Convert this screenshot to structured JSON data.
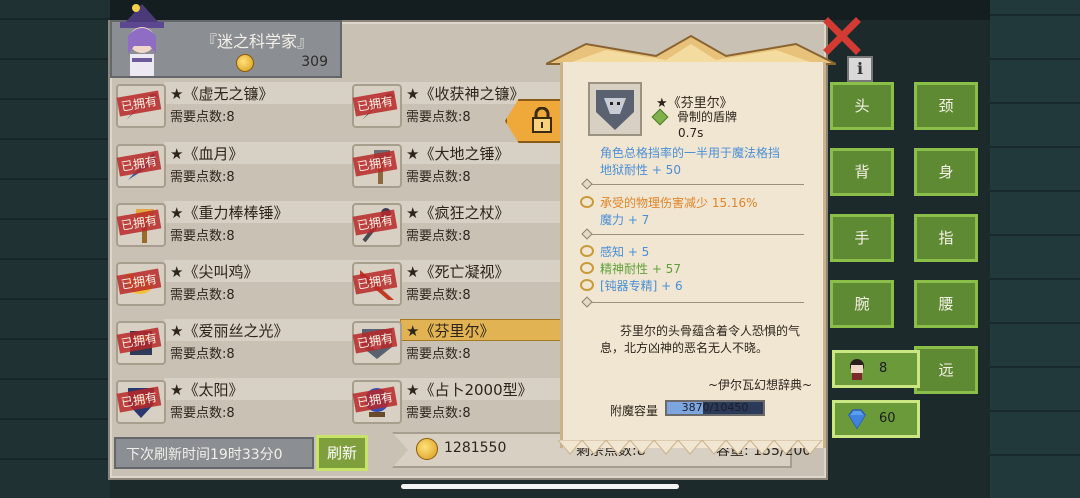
{
  "shop": {
    "name": "『迷之科学家』",
    "coins": "309"
  },
  "items": [
    {
      "name": "★《虚无之镰》",
      "cost": "需要点数:8",
      "owned": "已拥有"
    },
    {
      "name": "★《收获神之镰》",
      "cost": "需要点数:8",
      "owned": "已拥有"
    },
    {
      "name": "★《血月》",
      "cost": "需要点数:8",
      "owned": "已拥有"
    },
    {
      "name": "★《大地之锤》",
      "cost": "需要点数:8",
      "owned": "已拥有"
    },
    {
      "name": "★《重力棒棒锤》",
      "cost": "需要点数:8",
      "owned": "已拥有"
    },
    {
      "name": "★《疯狂之杖》",
      "cost": "需要点数:8",
      "owned": "已拥有"
    },
    {
      "name": "★《尖叫鸡》",
      "cost": "需要点数:8",
      "owned": "已拥有"
    },
    {
      "name": "★《死亡凝视》",
      "cost": "需要点数:8",
      "owned": "已拥有"
    },
    {
      "name": "★《爱丽丝之光》",
      "cost": "需要点数:8",
      "owned": "已拥有"
    },
    {
      "name": "★《芬里尔》",
      "cost": "需要点数:8",
      "owned": "已拥有"
    },
    {
      "name": "★《太阳》",
      "cost": "需要点数:8",
      "owned": "已拥有"
    },
    {
      "name": "★《占卜2000型》",
      "cost": "需要点数:8",
      "owned": "已拥有"
    }
  ],
  "footer": {
    "refresh_time": "下次刷新时间19时33分0",
    "refresh_button": "刷新",
    "gold": "1281550",
    "remaining": "剩余点数:8",
    "capacity": "容量: 155/200"
  },
  "detail": {
    "name": "★《芬里尔》",
    "type": "骨制的盾牌",
    "speed": "0.7s",
    "lines": [
      {
        "text": "角色总格挡率的一半用于魔法格挡",
        "color": "blue"
      },
      {
        "text": "地狱耐性 + 50",
        "color": "blue"
      },
      {
        "text": "承受的物理伤害减少 15.16%",
        "color": "orange"
      },
      {
        "text": "魔力 + 7",
        "color": "blue"
      },
      {
        "text": "感知 + 5",
        "color": "blue"
      },
      {
        "text": "精神耐性 + 57",
        "color": "green"
      },
      {
        "text": "[钝器专精] + 6",
        "color": "blue"
      }
    ],
    "lore": "芬里尔的头骨蕴含着令人恐惧的气息，北方凶神的恶名无人不晓。",
    "lore_source": "~伊尔瓦幻想辞典~",
    "enchant_label": "附魔容量",
    "enchant_value": "3870/10450",
    "enchant_fraction": 0.37
  },
  "slots": {
    "head": "头",
    "neck": "颈",
    "back": "背",
    "body": "身",
    "hand": "手",
    "finger": "指",
    "wrist": "腕",
    "waist": "腰",
    "ranged": "远"
  },
  "resources": {
    "characters": "8",
    "gems": "60"
  },
  "info_label": "i",
  "colors": {
    "blue": "#4a8fd6",
    "orange": "#e0842a",
    "green": "#5fa03a",
    "slot_green": "#5e8a33",
    "accent_gold": "#efa83a"
  }
}
